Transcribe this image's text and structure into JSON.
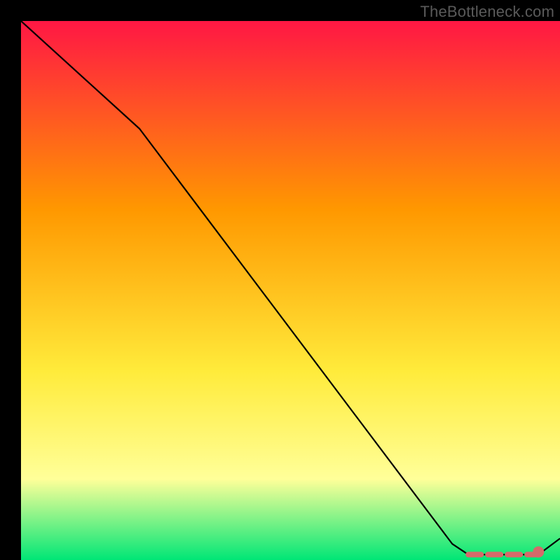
{
  "watermark": "TheBottleneck.com",
  "chart_data": {
    "type": "line",
    "title": "",
    "xlabel": "",
    "ylabel": "",
    "xlim": [
      0,
      100
    ],
    "ylim": [
      0,
      100
    ],
    "background_gradient_colors": [
      "#ff1744",
      "#ff9800",
      "#ffeb3b",
      "#ffff99",
      "#00e676"
    ],
    "curve": {
      "x": [
        0,
        22,
        80,
        83,
        96,
        100
      ],
      "y": [
        100,
        80,
        3,
        1,
        1,
        4
      ],
      "note": "single black line; starts top-left, kink early, descends to trough near x≈0.83–0.96, slight rise at right edge"
    },
    "dashed_segment": {
      "x": [
        83,
        96
      ],
      "y": [
        1,
        1
      ],
      "color": "#d46a6a",
      "note": "short salmon dashed line along trough of curve"
    },
    "marker": {
      "x": 96,
      "y": 1.5,
      "color": "#d46a6a",
      "note": "single salmon dot at right end of dashed segment"
    }
  }
}
